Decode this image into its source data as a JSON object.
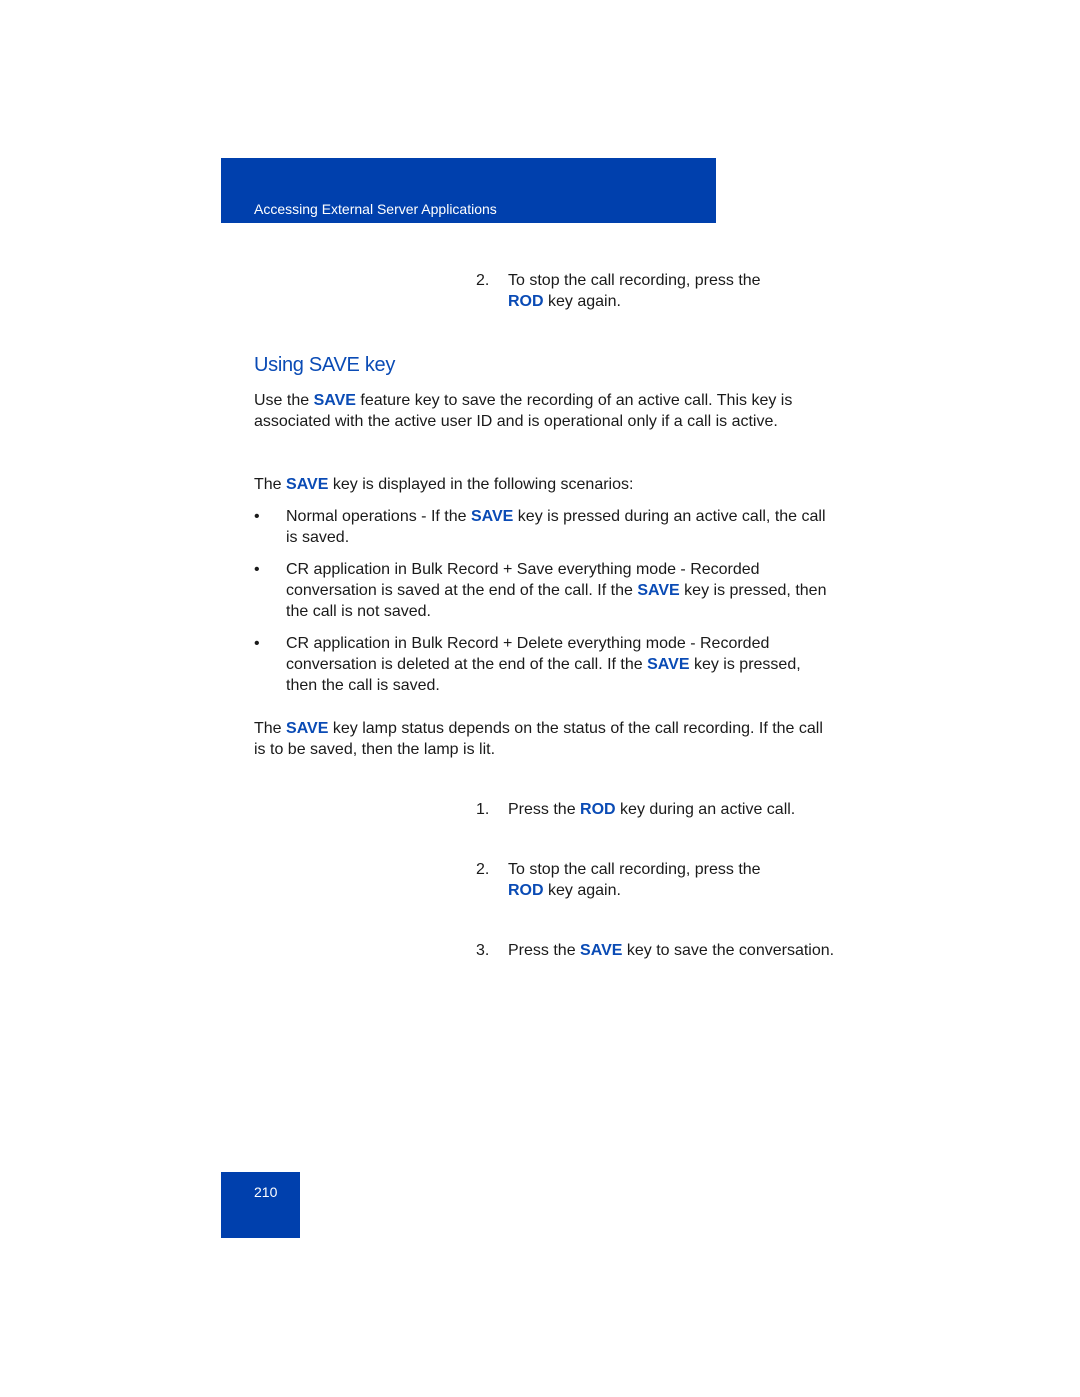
{
  "header": {
    "title": "Accessing External Server Applications"
  },
  "colors": {
    "brand_blue": "#0040ad",
    "keyword_blue": "#0a4bb5",
    "text": "#1a1a1a"
  },
  "top_step": {
    "number": "2.",
    "before": "To stop the call recording, press the ",
    "keyword": "ROD",
    "after": " key again."
  },
  "section": {
    "heading": "Using SAVE key",
    "intro": {
      "before": "Use the ",
      "keyword": "SAVE",
      "after": " feature key to save the recording of an active call. This key is associated with the active user ID and is operational only if a call is active."
    },
    "scenarios_intro": {
      "before": "The ",
      "keyword": "SAVE",
      "after": " key is displayed in the following scenarios:"
    },
    "bullets": [
      {
        "marker": "•",
        "before": "Normal operations - If the ",
        "keyword": "SAVE",
        "after": " key is pressed during an active call, the call is saved."
      },
      {
        "marker": "•",
        "before": "CR application in Bulk Record + Save everything mode - Recorded conversation is saved at the end of the call. If the ",
        "keyword": "SAVE",
        "after": " key is pressed, then the call is not saved."
      },
      {
        "marker": "•",
        "before": "CR application in Bulk Record + Delete everything mode - Recorded conversation is deleted at the end of the call. If the ",
        "keyword": "SAVE",
        "after": " key is pressed, then the call is saved."
      }
    ],
    "lamp_note": {
      "before": "The ",
      "keyword": "SAVE",
      "after": " key lamp status depends on the status of the call recording. If the call is to be saved, then the lamp is lit."
    },
    "steps": [
      {
        "number": "1.",
        "before": "Press the ",
        "keyword": "ROD",
        "after": " key during an active call."
      },
      {
        "number": "2.",
        "before": "To stop the call recording, press the ",
        "keyword": "ROD",
        "after": " key again."
      },
      {
        "number": "3.",
        "before": "Press the ",
        "keyword": "SAVE",
        "after": " key to save the conversation."
      }
    ]
  },
  "footer": {
    "page_number": "210"
  }
}
